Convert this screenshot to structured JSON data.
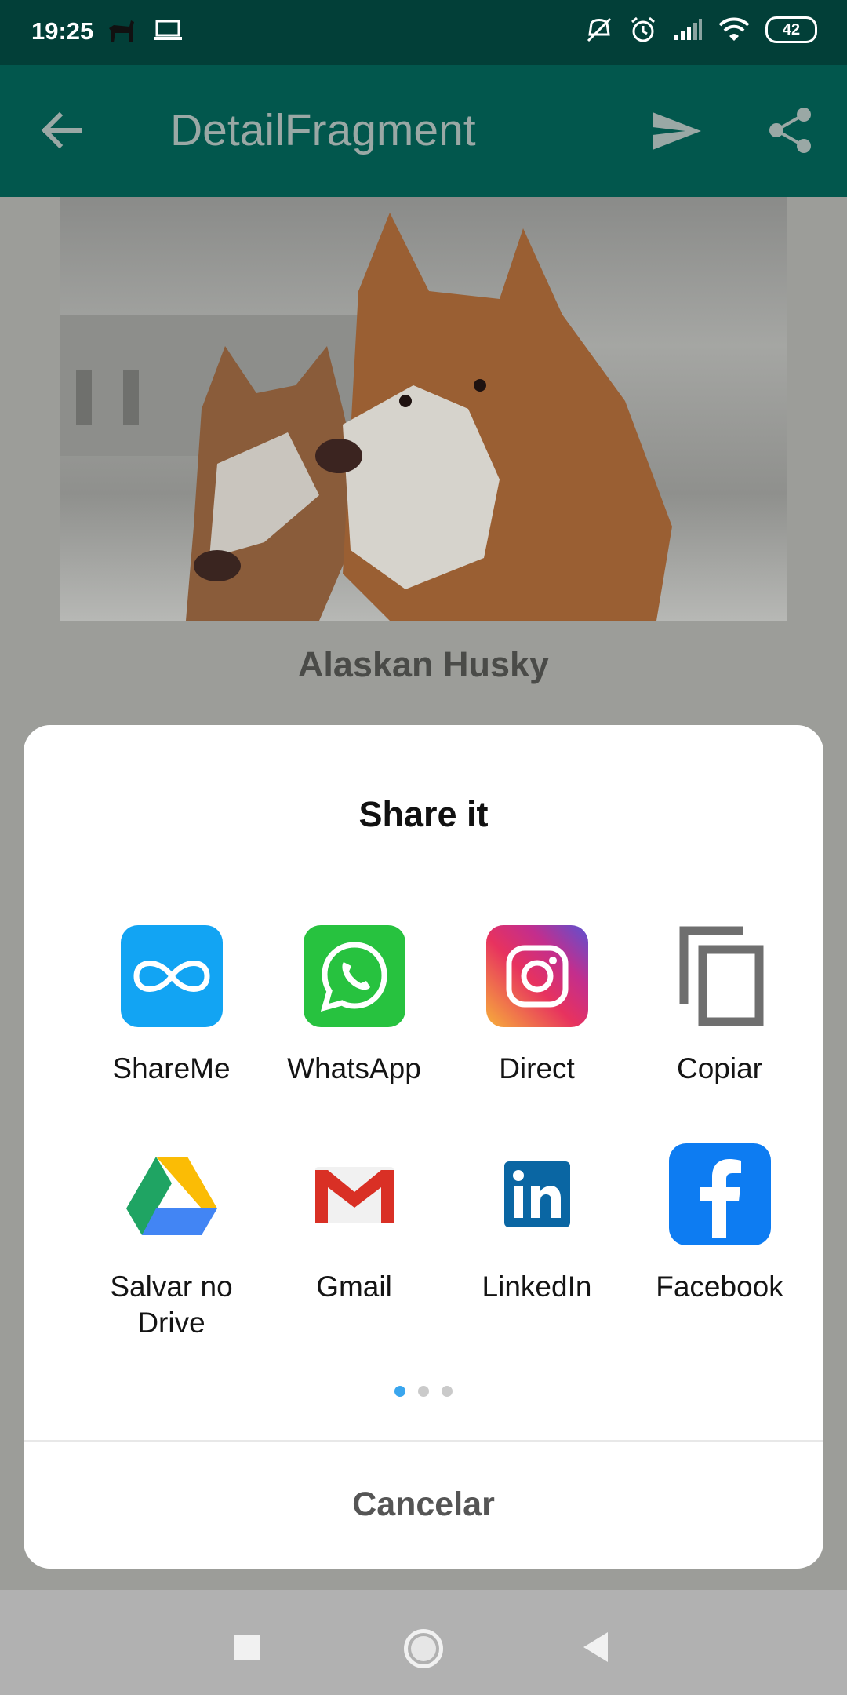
{
  "status_bar": {
    "time": "19:25",
    "battery": "42"
  },
  "app_bar": {
    "title": "DetailFragment"
  },
  "content": {
    "dog_name": "Alaskan Husky"
  },
  "share_sheet": {
    "title": "Share it",
    "apps": [
      {
        "label": "ShareMe",
        "icon": "shareme-icon"
      },
      {
        "label": "WhatsApp",
        "icon": "whatsapp-icon"
      },
      {
        "label": "Direct",
        "icon": "instagram-icon"
      },
      {
        "label": "Copiar",
        "icon": "copy-icon"
      },
      {
        "label": "Salvar no\nDrive",
        "icon": "google-drive-icon"
      },
      {
        "label": "Gmail",
        "icon": "gmail-icon"
      },
      {
        "label": "LinkedIn",
        "icon": "linkedin-icon"
      },
      {
        "label": "Facebook",
        "icon": "facebook-icon"
      }
    ],
    "page_count": 3,
    "active_page": 1,
    "cancel_label": "Cancelar"
  },
  "colors": {
    "status_bar": "#023f38",
    "app_bar": "#02574d",
    "active_dot": "#3aa6ee"
  }
}
